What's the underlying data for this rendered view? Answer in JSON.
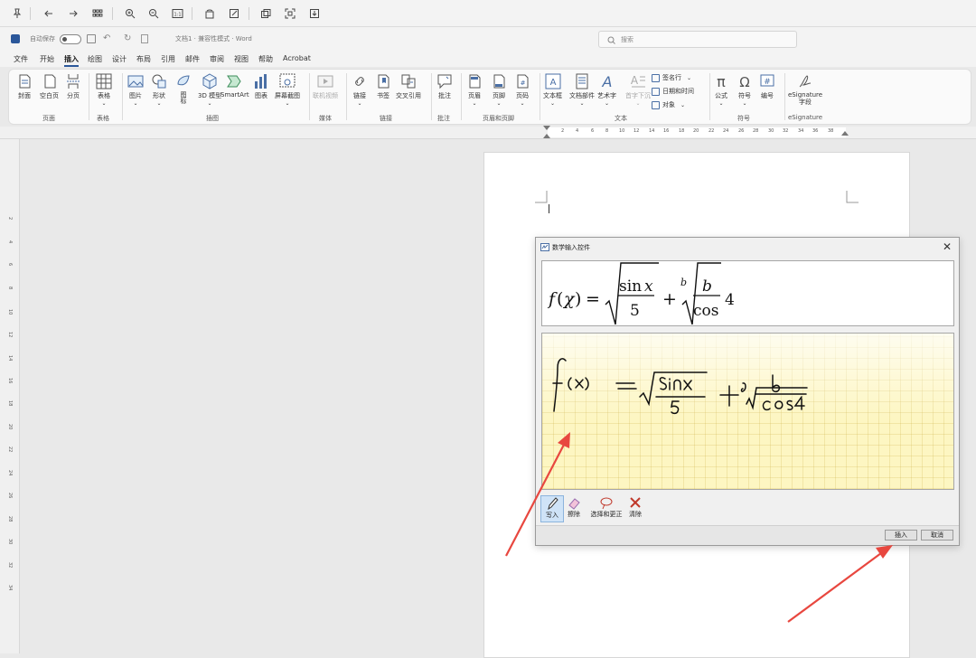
{
  "viewer_toolbar": {
    "icons": [
      "pin-icon",
      "back-arrow-icon",
      "forward-arrow-icon",
      "grid-icon",
      "zoom-in-icon",
      "zoom-out-icon",
      "actual-size-icon",
      "rotate-icon",
      "edit-icon",
      "copy-icon",
      "crop-icon",
      "save-icon"
    ]
  },
  "title_bar": {
    "autosave_label": "自动保存",
    "doc_title": "文档1 · 兼容性模式 · Word",
    "search_placeholder": "搜索"
  },
  "tabs": [
    "文件",
    "开始",
    "插入",
    "绘图",
    "设计",
    "布局",
    "引用",
    "邮件",
    "审阅",
    "视图",
    "帮助",
    "Acrobat"
  ],
  "active_tab": "插入",
  "ribbon": {
    "groups": [
      {
        "name": "页面",
        "buttons": [
          "封面",
          "空白页",
          "分页"
        ]
      },
      {
        "name": "表格",
        "buttons": [
          "表格"
        ]
      },
      {
        "name": "插图",
        "buttons": [
          "图片",
          "形状",
          "图标",
          "3D 模型",
          "SmartArt",
          "图表",
          "屏幕截图"
        ]
      },
      {
        "name": "媒体",
        "buttons": [
          "联机视频"
        ]
      },
      {
        "name": "链接",
        "buttons": [
          "链接",
          "书签",
          "交叉引用"
        ]
      },
      {
        "name": "批注",
        "buttons": [
          "批注"
        ]
      },
      {
        "name": "页眉和页脚",
        "buttons": [
          "页眉",
          "页脚",
          "页码"
        ]
      },
      {
        "name": "文本",
        "buttons": [
          "文本框",
          "文档部件",
          "艺术字",
          "首字下沉"
        ],
        "small": [
          "签名行",
          "日期和时间",
          "对象"
        ]
      },
      {
        "name": "符号",
        "buttons": [
          "公式",
          "符号",
          "编号"
        ]
      },
      {
        "name": "eSignature",
        "buttons": [
          "eSignature\n字段"
        ]
      }
    ]
  },
  "ruler_numbers": [
    "2",
    "4",
    "6",
    "8",
    "10",
    "12",
    "14",
    "16",
    "18",
    "20",
    "22",
    "24",
    "26",
    "28",
    "30",
    "32",
    "34",
    "36",
    "38"
  ],
  "vruler_numbers": [
    "2",
    "4",
    "6",
    "8",
    "10",
    "12",
    "14",
    "16",
    "18",
    "20",
    "22",
    "24",
    "26",
    "28",
    "30",
    "32",
    "34"
  ],
  "dialog": {
    "title": "数学输入控件",
    "preview": {
      "f": "f",
      "x": "χ",
      "eq": "=",
      "sin": "sin",
      "sx": "x",
      "five": "5",
      "plus": "+",
      "b_idx": "b",
      "b": "b",
      "cos": "cos",
      "four": "4"
    },
    "tools": [
      "写入",
      "擦除",
      "选择和更正",
      "清除"
    ],
    "insert_button": "插入",
    "cancel_button": "取消"
  },
  "colors": {
    "accent": "#2b579a",
    "ink_bg": "#fdf6c2",
    "arrow": "#e8473f"
  }
}
